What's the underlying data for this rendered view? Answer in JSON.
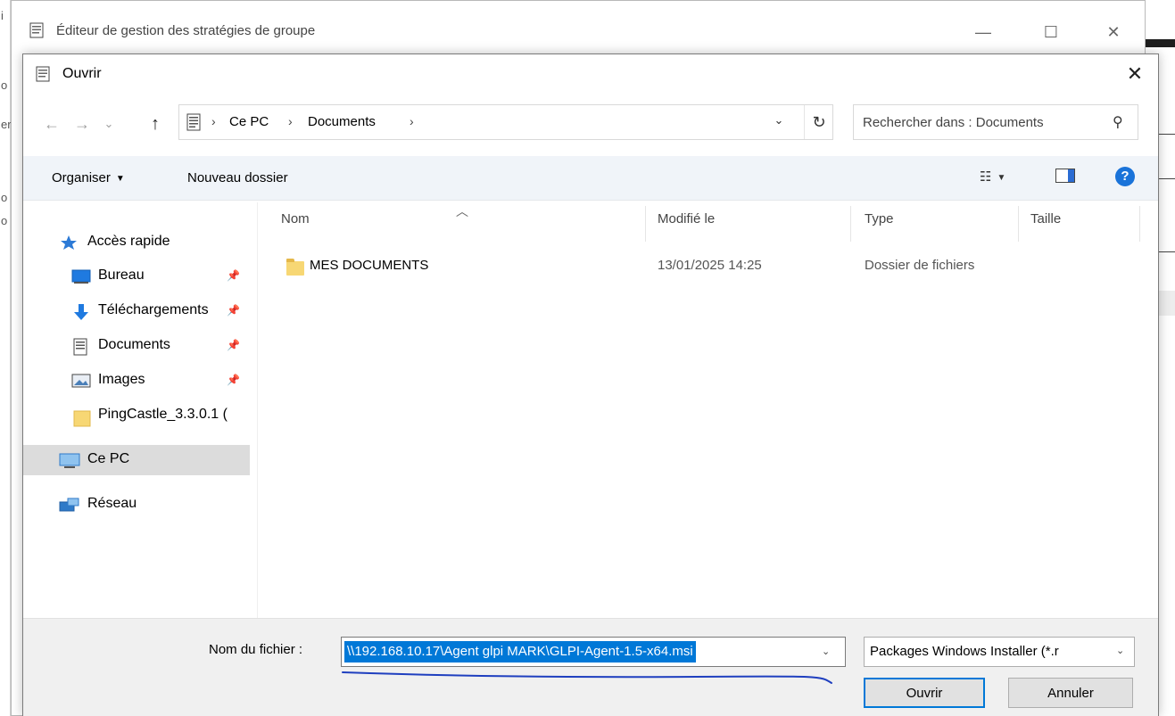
{
  "background": {
    "fragments": [
      "i",
      "o",
      "er",
      "o",
      "o"
    ]
  },
  "gpo_window": {
    "title": "Éditeur de gestion des stratégies de groupe",
    "icons": {
      "title": "document-icon"
    }
  },
  "dialog": {
    "title": "Ouvrir",
    "close_label": "✕",
    "nav": {
      "back": "←",
      "forward": "→",
      "recent": "⌄",
      "up": "↑"
    },
    "address": {
      "crumbs": [
        "Ce PC",
        "Documents"
      ],
      "separator": "›",
      "dropdown": "⌄",
      "refresh": "↻"
    },
    "search": {
      "placeholder": "Rechercher dans : Documents"
    },
    "toolbar": {
      "organize_label": "Organiser",
      "new_folder_label": "Nouveau dossier"
    },
    "navigation": {
      "quick_access": "Accès rapide",
      "items": [
        {
          "label": "Bureau",
          "icon": "desktop-icon",
          "pinned": true
        },
        {
          "label": "Téléchargements",
          "icon": "download-icon",
          "pinned": true
        },
        {
          "label": "Documents",
          "icon": "documents-icon",
          "pinned": true
        },
        {
          "label": "Images",
          "icon": "images-icon",
          "pinned": true
        },
        {
          "label": "PingCastle_3.3.0.1 (",
          "icon": "folder-icon",
          "pinned": false
        }
      ],
      "this_pc": "Ce PC",
      "network": "Réseau"
    },
    "columns": {
      "name": "Nom",
      "modified": "Modifié le",
      "type": "Type",
      "size": "Taille"
    },
    "files": [
      {
        "name": "MES DOCUMENTS",
        "modified": "13/01/2025 14:25",
        "type": "Dossier de fichiers",
        "size": ""
      }
    ],
    "filename": {
      "label": "Nom du fichier :",
      "value": "\\\\192.168.10.17\\Agent glpi MARK\\GLPI-Agent-1.5-x64.msi"
    },
    "filetype": {
      "value": "Packages Windows Installer (*.r"
    },
    "buttons": {
      "open": "Ouvrir",
      "cancel": "Annuler"
    },
    "colors": {
      "accent": "#0078d7",
      "annotation": "#1f3fbf",
      "help": "#1a73d9"
    }
  }
}
